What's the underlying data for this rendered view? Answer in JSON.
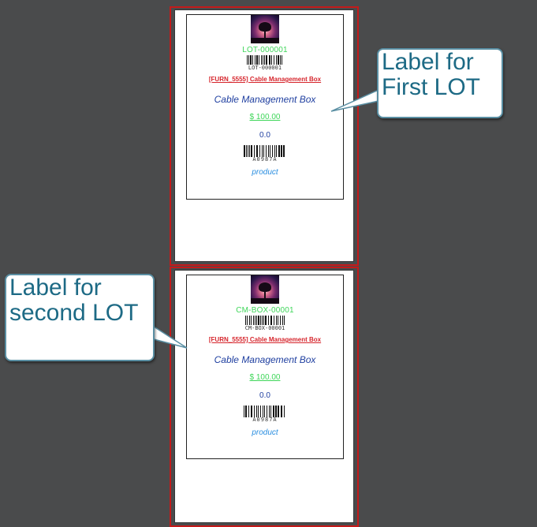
{
  "labels": [
    {
      "lot_name": "LOT-000001",
      "lot_barcode_text": "LOT-000001",
      "product_ref": "[FURN_5555] Cable Management Box",
      "product_name": "Cable Management Box",
      "price": "$ 100.00",
      "quantity": "0.0",
      "product_barcode_text": "A0987A",
      "category": "product"
    },
    {
      "lot_name": "CM-BOX-00001",
      "lot_barcode_text": "CM-BOX-00001",
      "product_ref": "[FURN_5555] Cable Management Box",
      "product_name": "Cable Management Box",
      "price": "$ 100.00",
      "quantity": "0.0",
      "product_barcode_text": "A0987A",
      "category": "product"
    }
  ],
  "callouts": {
    "first": {
      "line1": "Label for",
      "line2": "First LOT"
    },
    "second": {
      "line1": "Label for",
      "line2": "second LOT"
    }
  },
  "icons": {
    "product_image": "product-thumbnail-tree-sunset"
  },
  "colors": {
    "background": "#4a4b4c",
    "page_border": "#c41a1a",
    "lot_name": "#3fd65a",
    "product_ref": "#d6262d",
    "product_name": "#1f3fa0",
    "category": "#2a8ee0",
    "callout_text": "#1d6a85",
    "callout_border": "#5a8fa3"
  }
}
